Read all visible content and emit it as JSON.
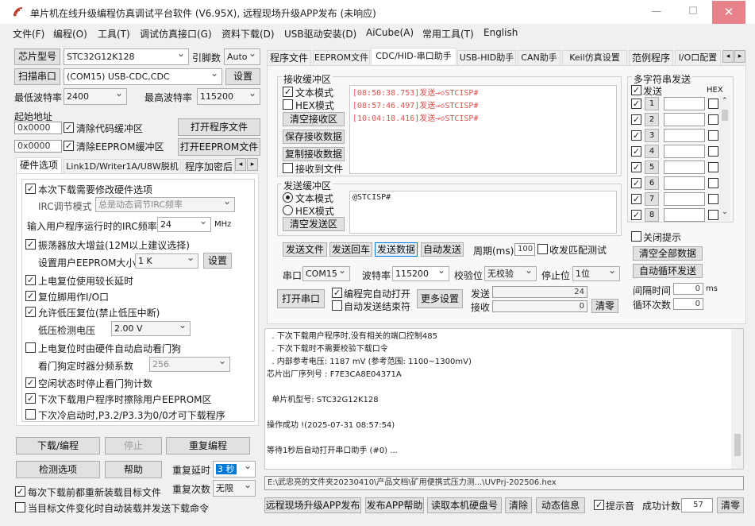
{
  "window": {
    "title": "单片机在线升级编程仿真调试平台软件 (V6.95X), 远程现场升级APP发布 (未响应)",
    "min_icon": "minimize-icon",
    "max_icon": "maximize-icon",
    "close_glyph": "✕"
  },
  "menu": [
    "文件(F)",
    "编程(O)",
    "工具(T)",
    "调试仿真接口(G)",
    "资料下载(D)",
    "USB驱动安装(D)",
    "AiCube(A)",
    "常用工具(T)",
    "English"
  ],
  "left": {
    "chip_btn": "芯片型号",
    "chip_value": "STC32G12K128",
    "pin_label": "引脚数",
    "pin_value": "Auto",
    "scan_btn": "扫描串口",
    "port_value": "(COM15) USB-CDC,CDC",
    "settings_btn": "设置",
    "min_baud_label": "最低波特率",
    "min_baud_value": "2400",
    "max_baud_label": "最高波特率",
    "max_baud_value": "115200",
    "start_addr_label": "起始地址",
    "addr1": "0x0000",
    "clear_code_label": "清除代码缓冲区",
    "open_prog_btn": "打开程序文件",
    "addr2": "0x0000",
    "clear_eeprom_label": "清除EEPROM缓冲区",
    "open_eeprom_btn": "打开EEPROM文件",
    "tabs": [
      "硬件选项",
      "Link1D/Writer1A/U8W脱机",
      "程序加密后"
    ],
    "hw": {
      "modify_hw": "本次下载需要修改硬件选项",
      "irc_mode_label": "IRC调节模式",
      "irc_mode_value": "总是动态调节IRC频率",
      "irc_freq_label": "输入用户程序运行时的IRC频率",
      "irc_freq_value": "24",
      "mhz": "MHz",
      "osc_gain": "振荡器放大增益(12M以上建议选择)",
      "eeprom_size_label": "设置用户EEPROM大小",
      "eeprom_size_value": "1   K",
      "eeprom_set_btn": "设置",
      "power_delay": "上电复位使用较长延时",
      "reset_io": "复位脚用作I/O口",
      "lvd_reset": "允许低压复位(禁止低压中断)",
      "lvd_label": "低压检测电压",
      "lvd_value": "2.00 V",
      "wdt_auto": "上电复位时由硬件自动启动看门狗",
      "wdt_div_label": "看门狗定时器分频系数",
      "wdt_div_value": "256",
      "idle_wdt": "空闲状态时停止看门狗计数",
      "erase_eeprom": "下次下载用户程序时擦除用户EEPROM区",
      "cold_boot": "下次冷启动时,P3.2/P3.3为0/0才可下载程序"
    },
    "download_btn": "下载/编程",
    "stop_btn": "停止",
    "reprog_btn": "重复编程",
    "check_btn": "检测选项",
    "help_btn": "帮助",
    "repeat_delay_label": "重复延时",
    "repeat_delay_value": "3 秒",
    "repeat_count_label": "重复次数",
    "repeat_count_value": "无限",
    "reload_each": "每次下载前都重新装载目标文件",
    "auto_on_change": "当目标文件变化时自动装载并发送下载命令"
  },
  "right": {
    "tabs": [
      "程序文件",
      "EEPROM文件",
      "CDC/HID-串口助手",
      "USB-HID助手",
      "CAN助手",
      "Keil仿真设置",
      "范例程序",
      "I/O口配置"
    ],
    "recv_group": "接收缓冲区",
    "recv_text_mode": "文本模式",
    "recv_hex_mode": "HEX模式",
    "clear_recv": "清空接收区",
    "save_recv": "保存接收数据",
    "copy_recv": "复制接收数据",
    "recv_to_file": "接收到文件",
    "recv_lines": [
      "[08:50:38.753]发送→◇STCISP#",
      "[08:57:46.497]发送→◇STCISP#",
      "[10:04:18.416]发送→◇STCISP#"
    ],
    "send_group": "发送缓冲区",
    "send_text_mode": "文本模式",
    "send_hex_mode": "HEX模式",
    "clear_send": "清空发送区",
    "send_text": "@STCISP#",
    "send_file_btn": "发送文件",
    "send_return_btn": "发送回车",
    "send_data_btn": "发送数据",
    "auto_send_btn": "自动发送",
    "period_label": "周期(ms)",
    "period_value": "100",
    "match_test": "收发匹配测试",
    "port_label": "串口",
    "port_value": "COM15",
    "baud_label": "波特率",
    "baud_value": "115200",
    "parity_label": "校验位",
    "parity_value": "无校验",
    "stop_label": "停止位",
    "stop_value": "1位",
    "open_port_btn": "打开串口",
    "auto_open": "编程完自动打开",
    "auto_stop": "自动发送结束符",
    "more_settings_btn": "更多设置",
    "tx_label": "发送",
    "tx_value": "24",
    "rx_label": "接收",
    "rx_value": "0",
    "clear_count_btn": "清零",
    "multi_title": "多字符串发送",
    "multi_send_col": "发送",
    "multi_hex_col": "HEX",
    "multi_rows": [
      "1",
      "2",
      "3",
      "4",
      "5",
      "6",
      "7",
      "8"
    ],
    "close_tip": "关闭提示",
    "clear_all_btn": "清空全部数据",
    "auto_loop_btn": "自动循环发送",
    "interval_label": "间隔时间",
    "interval_value": "0",
    "interval_unit": "ms",
    "loop_count_label": "循环次数",
    "loop_count_value": "0"
  },
  "log": {
    "lines": [
      "  . 下次下载用户程序时,没有相关的端口控制485",
      "  . 下次下载时不需要校验下载口令",
      "  . 内部参考电压: 1187 mV (参考范围: 1100~1300mV)",
      "芯片出厂序列号 : F7E3CA8E04371A",
      "",
      "  单片机型号: STC32G12K128",
      "",
      "操作成功 !(2025-07-31 08:57:54)",
      "",
      "等待1秒后自动打开串口助手 (#0) ..."
    ]
  },
  "path": "E:\\武忠亮的文件夹20230410\\产品文档\\矿用便携式压力测...\\UVPrj-202506.hex",
  "bottom": {
    "publish_btn": "远程现场升级APP发布",
    "app_help_btn": "发布APP帮助",
    "read_disk_btn": "读取本机硬盘号",
    "clear_btn": "清除",
    "anim_btn": "动态信息",
    "sound_label": "提示音",
    "success_label": "成功计数",
    "success_value": "57",
    "clear2_btn": "清零"
  }
}
